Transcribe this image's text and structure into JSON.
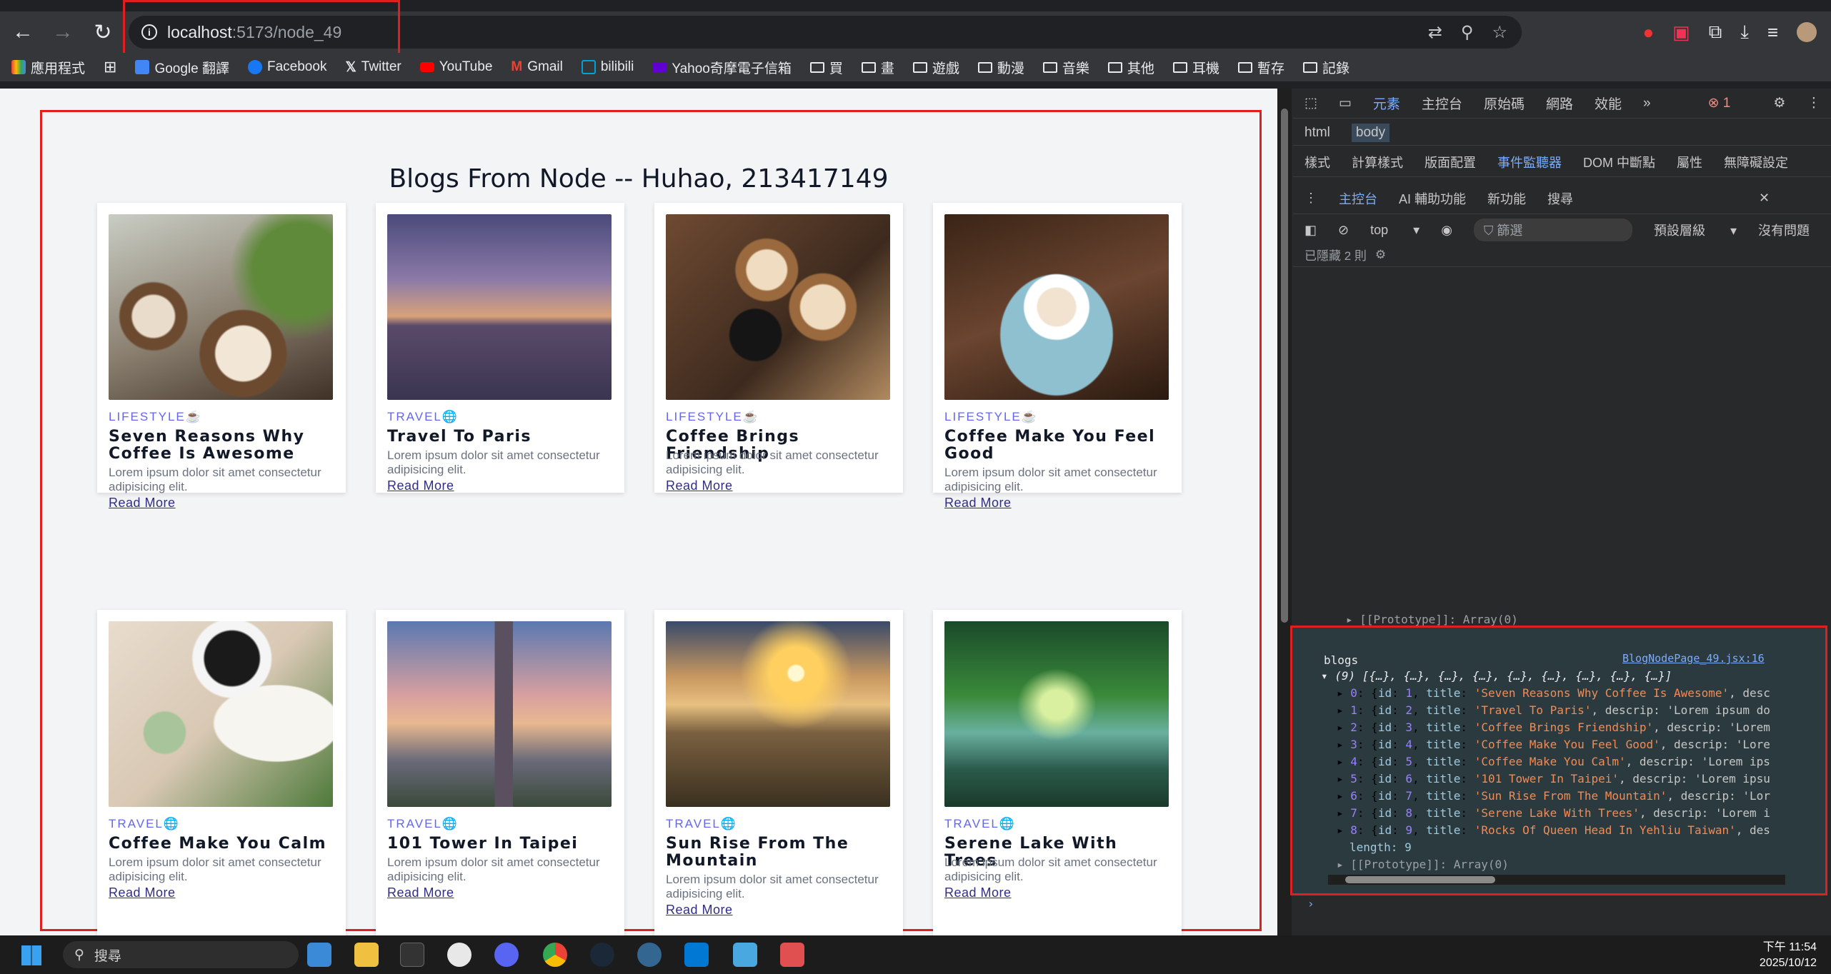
{
  "browser": {
    "url_host": "localhost",
    "url_path": ":5173/node_49"
  },
  "bookmarks": [
    "應用程式",
    "Google 翻譯",
    "Facebook",
    "Twitter",
    "YouTube",
    "Gmail",
    "bilibili",
    "Yahoo奇摩電子信箱",
    "買",
    "畫",
    "遊戲",
    "動漫",
    "音樂",
    "其他",
    "耳機",
    "暫存",
    "記錄"
  ],
  "page": {
    "title": "Blogs From Node -- Huhao, 213417149",
    "cards": [
      {
        "category": "LIFESTYLE",
        "title": "Seven Reasons Why Coffee Is Awesome",
        "desc": "Lorem ipsum dolor sit amet consectetur adipisicing elit.",
        "link": "Read More"
      },
      {
        "category": "TRAVEL",
        "title": "Travel To Paris",
        "desc": "Lorem ipsum dolor sit amet consectetur adipisicing elit.",
        "link": "Read More"
      },
      {
        "category": "LIFESTYLE",
        "title": "Coffee Brings Friendship",
        "desc": "Lorem ipsum dolor sit amet consectetur adipisicing elit.",
        "link": "Read More"
      },
      {
        "category": "LIFESTYLE",
        "title": "Coffee Make You Feel Good",
        "desc": "Lorem ipsum dolor sit amet consectetur adipisicing elit.",
        "link": "Read More"
      },
      {
        "category": "TRAVEL",
        "title": "Coffee Make You Calm",
        "desc": "Lorem ipsum dolor sit amet consectetur adipisicing elit.",
        "link": "Read More"
      },
      {
        "category": "TRAVEL",
        "title": "101 Tower In Taipei",
        "desc": "Lorem ipsum dolor sit amet consectetur adipisicing elit.",
        "link": "Read More"
      },
      {
        "category": "TRAVEL",
        "title": "Sun Rise From The Mountain",
        "desc": "Lorem ipsum dolor sit amet consectetur adipisicing elit.",
        "link": "Read More"
      },
      {
        "category": "TRAVEL",
        "title": "Serene Lake With Trees",
        "desc": "Lorem ipsum dolor sit amet consectetur adipisicing elit.",
        "link": "Read More"
      }
    ]
  },
  "devtools": {
    "tabs": [
      "元素",
      "主控台",
      "原始碼",
      "網路",
      "效能"
    ],
    "breadcrumb": [
      "html",
      "body"
    ],
    "subtabs": [
      "樣式",
      "計算樣式",
      "版面配置",
      "事件監聽器",
      "DOM 中斷點",
      "屬性",
      "無障礙設定"
    ],
    "drawer_tabs": [
      "主控台",
      "AI 輔助功能",
      "新功能",
      "搜尋"
    ],
    "context": "top",
    "filter_placeholder": "篩選",
    "levels": "預設層級",
    "issues": "沒有問題",
    "hidden": "已隱藏 2 則",
    "error_count": "1",
    "prototype_line": "[[Prototype]]: Array(0)",
    "log_label": "blogs",
    "log_source": "BlogNodePage_49.jsx:16",
    "log_summary": "(9) [{…}, {…}, {…}, {…}, {…}, {…}, {…}, {…}, {…}]",
    "items": [
      {
        "idx": "0",
        "id": "1",
        "title": "'Seven Reasons Why Coffee Is Awesome'",
        "rest": ", desc"
      },
      {
        "idx": "1",
        "id": "2",
        "title": "'Travel To Paris'",
        "rest": ", descrip: 'Lorem ipsum do"
      },
      {
        "idx": "2",
        "id": "3",
        "title": "'Coffee Brings Friendship'",
        "rest": ", descrip: 'Lorem"
      },
      {
        "idx": "3",
        "id": "4",
        "title": "'Coffee Make You Feel Good'",
        "rest": ", descrip: 'Lore"
      },
      {
        "idx": "4",
        "id": "5",
        "title": "'Coffee Make You Calm'",
        "rest": ", descrip: 'Lorem ips"
      },
      {
        "idx": "5",
        "id": "6",
        "title": "'101 Tower In Taipei'",
        "rest": ", descrip: 'Lorem ipsu"
      },
      {
        "idx": "6",
        "id": "7",
        "title": "'Sun Rise From The Mountain'",
        "rest": ", descrip: 'Lor"
      },
      {
        "idx": "7",
        "id": "8",
        "title": "'Serene Lake With Trees'",
        "rest": ", descrip: 'Lorem i"
      },
      {
        "idx": "8",
        "id": "9",
        "title": "'Rocks Of Queen Head In Yehliu Taiwan'",
        "rest": ", des"
      }
    ],
    "length_line": "length: 9"
  },
  "taskbar": {
    "search": "搜尋",
    "time": "下午 11:54",
    "date": "2025/10/12"
  }
}
